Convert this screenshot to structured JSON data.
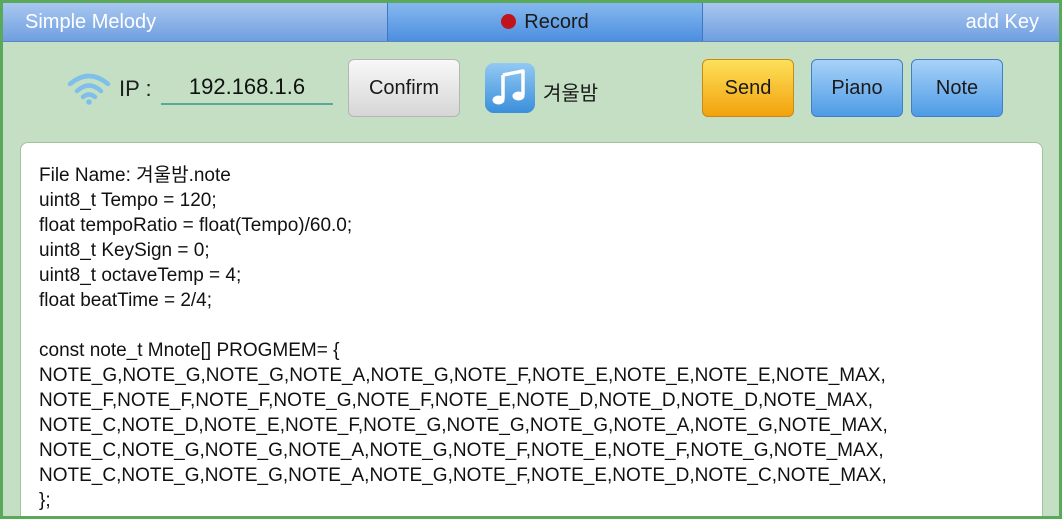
{
  "tabs": {
    "left": "Simple Melody",
    "center": "Record",
    "right": "add Key"
  },
  "toolbar": {
    "ip_label": "IP :",
    "ip_value": "192.168.1.6",
    "confirm_label": "Confirm",
    "song_name": "겨울밤",
    "send_label": "Send",
    "piano_label": "Piano",
    "note_label": "Note"
  },
  "code": {
    "lines": [
      "File Name: 겨울밤.note",
      "uint8_t Tempo = 120;",
      "float tempoRatio = float(Tempo)/60.0;",
      "uint8_t KeySign = 0;",
      "uint8_t octaveTemp = 4;",
      "float beatTime = 2/4;",
      "",
      "const note_t Mnote[] PROGMEM= {",
      "NOTE_G,NOTE_G,NOTE_G,NOTE_A,NOTE_G,NOTE_F,NOTE_E,NOTE_E,NOTE_E,NOTE_MAX,",
      "NOTE_F,NOTE_F,NOTE_F,NOTE_G,NOTE_F,NOTE_E,NOTE_D,NOTE_D,NOTE_D,NOTE_MAX,",
      "NOTE_C,NOTE_D,NOTE_E,NOTE_F,NOTE_G,NOTE_G,NOTE_G,NOTE_A,NOTE_G,NOTE_MAX,",
      "NOTE_C,NOTE_G,NOTE_G,NOTE_A,NOTE_G,NOTE_F,NOTE_E,NOTE_F,NOTE_G,NOTE_MAX,",
      "NOTE_C,NOTE_G,NOTE_G,NOTE_A,NOTE_G,NOTE_F,NOTE_E,NOTE_D,NOTE_C,NOTE_MAX,",
      "};"
    ]
  },
  "colors": {
    "background": "#c5dfc5",
    "tab_bar": "#6f9fe0",
    "record_dot": "#c0141c",
    "send_button": "#f3a20d",
    "blue_button": "#4e9be6"
  },
  "icons": [
    "wifi-icon",
    "record-dot-icon",
    "music-note-icon"
  ]
}
